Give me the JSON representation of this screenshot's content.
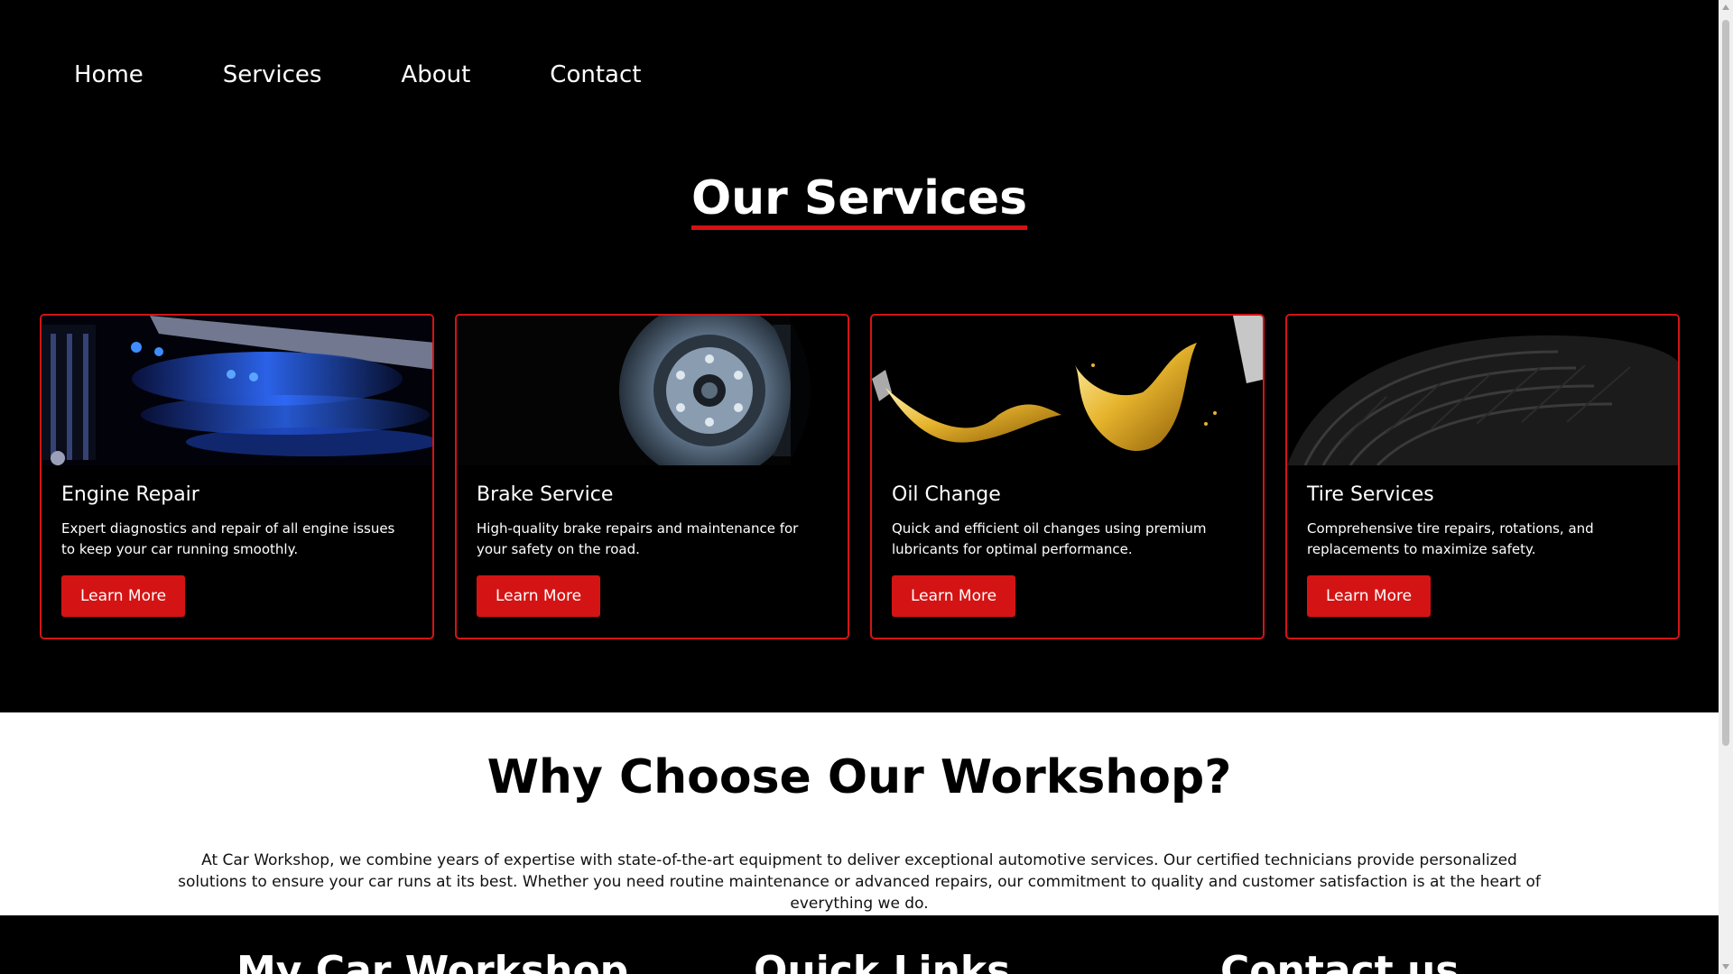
{
  "nav": {
    "items": [
      "Home",
      "Services",
      "About",
      "Contact"
    ]
  },
  "services": {
    "title": "Our Services",
    "cards": [
      {
        "icon": "engine-image",
        "title": "Engine Repair",
        "desc": "Expert diagnostics and repair of all engine issues to keep your car running smoothly.",
        "button": "Learn More"
      },
      {
        "icon": "brake-disc-image",
        "title": "Brake Service",
        "desc": "High-quality brake repairs and maintenance for your safety on the road.",
        "button": "Learn More"
      },
      {
        "icon": "oil-splash-image",
        "title": "Oil Change",
        "desc": "Quick and efficient oil changes using premium lubricants for optimal performance.",
        "button": "Learn More"
      },
      {
        "icon": "tire-image",
        "title": "Tire Services",
        "desc": "Comprehensive tire repairs, rotations, and replacements to maximize safety.",
        "button": "Learn More"
      }
    ]
  },
  "why": {
    "title": "Why Choose Our Workshop?",
    "text": "At Car Workshop, we combine years of expertise with state-of-the-art equipment to deliver exceptional automotive services. Our certified technicians provide personalized solutions to ensure your car runs at its best. Whether you need routine maintenance or advanced repairs, our commitment to quality and customer satisfaction is at the heart of everything we do."
  },
  "footer": {
    "col1": "My Car Workshop",
    "col2": "Quick Links",
    "col3": "Contact us"
  },
  "colors": {
    "accent": "#d41414",
    "background": "#000000",
    "section_light": "#ffffff"
  }
}
